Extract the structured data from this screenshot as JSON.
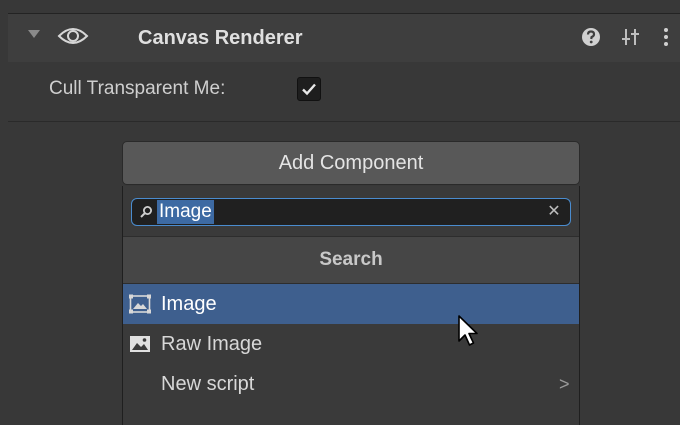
{
  "component": {
    "title": "Canvas Renderer",
    "property_label": "Cull Transparent Me:",
    "cull_transparent_mesh_checked": true
  },
  "add_component": {
    "button_label": "Add Component",
    "search": {
      "value": "Image",
      "header": "Search"
    },
    "results": [
      {
        "label": "Image",
        "icon": "image-icon",
        "selected": true
      },
      {
        "label": "Raw Image",
        "icon": "raw-image-icon",
        "selected": false
      },
      {
        "label": "New script",
        "icon": "",
        "selected": false,
        "has_submenu": true
      }
    ],
    "submenu_chevron": ">"
  },
  "icons": {
    "visibility": "eye-icon",
    "help": "help-icon",
    "presets": "presets-icon",
    "menu": "kebab-menu-icon",
    "search": "search-icon",
    "clear": "close-icon",
    "cursor": "mouse-cursor-icon"
  },
  "colors": {
    "background": "#383838",
    "selection": "#3e5f8e",
    "search_highlight": "#3d6aa3",
    "focus_border": "#4a8ccf"
  }
}
